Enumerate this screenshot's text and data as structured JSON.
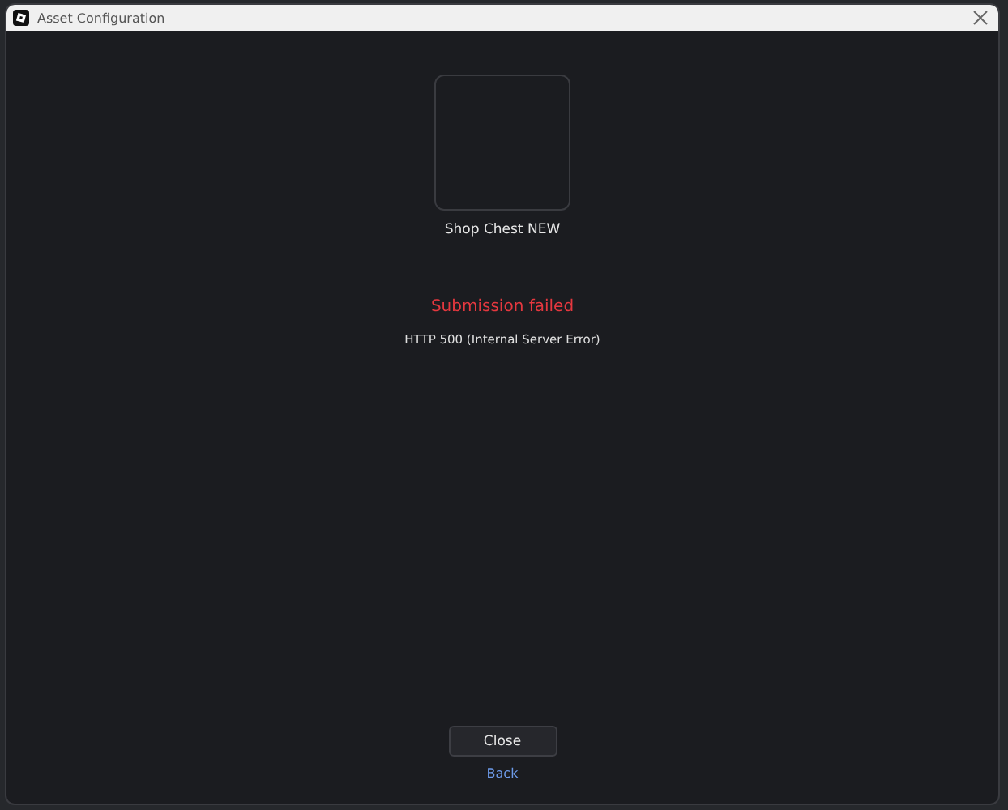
{
  "window": {
    "title": "Asset Configuration"
  },
  "asset": {
    "name": "Shop Chest NEW"
  },
  "error": {
    "title": "Submission failed",
    "message": "HTTP 500 (Internal Server Error)"
  },
  "buttons": {
    "close": "Close",
    "back": "Back"
  }
}
